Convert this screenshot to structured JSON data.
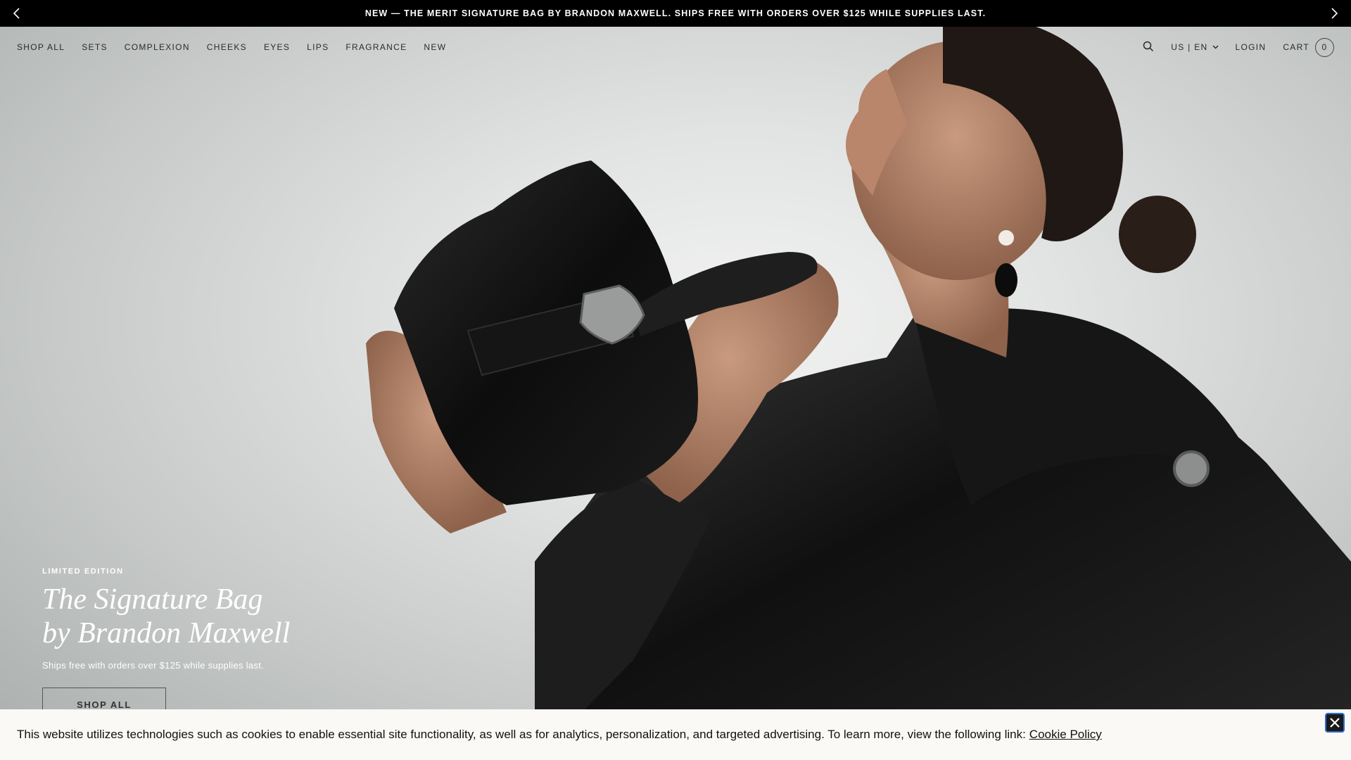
{
  "announcement": {
    "message": "NEW — THE MERIT SIGNATURE BAG BY BRANDON MAXWELL. SHIPS FREE WITH ORDERS OVER $125 WHILE SUPPLIES LAST.",
    "link_text": ""
  },
  "nav": {
    "items": [
      "SHOP ALL",
      "SETS",
      "COMPLEXION",
      "CHEEKS",
      "EYES",
      "LIPS",
      "FRAGRANCE",
      "NEW"
    ],
    "locale": "US | EN",
    "login": "LOGIN",
    "cart_label": "CART",
    "cart_count": "0"
  },
  "hero": {
    "eyebrow": "LIMITED EDITION",
    "title_line1": "The Signature Bag",
    "title_line2": "by Brandon Maxwell",
    "subtitle": "Ships free with orders over $125 while supplies last.",
    "cta": "SHOP ALL"
  },
  "cookie": {
    "text": "This website utilizes technologies such as cookies to enable essential site functionality, as well as for analytics, personalization, and targeted advertising. To learn more, view the following link:",
    "link": "Cookie Policy"
  },
  "colors": {
    "bar": "#000000",
    "banner_bg": "#faf9f6",
    "focus_ring": "#2f6bd8"
  }
}
